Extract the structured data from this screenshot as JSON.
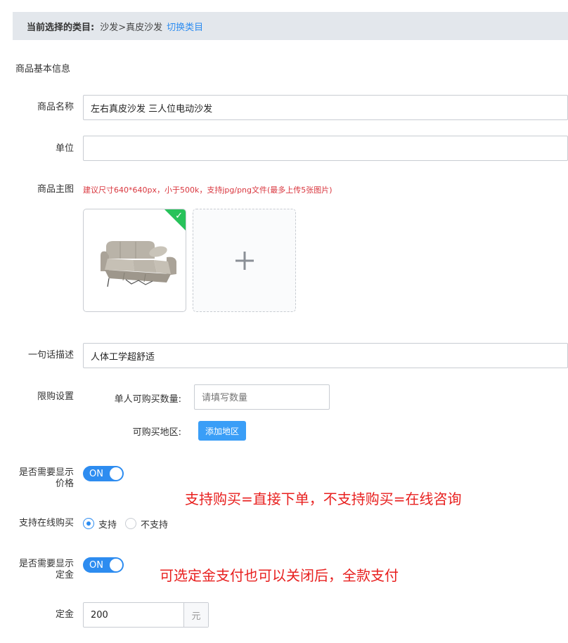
{
  "category_bar": {
    "label": "当前选择的类目:",
    "path": "沙发>真皮沙发",
    "switch_link": "切换类目"
  },
  "section_title": "商品基本信息",
  "product_name": {
    "label": "商品名称",
    "value": "左右真皮沙发 三人位电动沙发"
  },
  "unit": {
    "label": "单位",
    "value": ""
  },
  "main_image": {
    "label": "商品主图",
    "hint": "建议尺寸640*640px，小于500k，支持jpg/png文件(最多上传5张图片)",
    "uploaded_count": 1,
    "upload_icon": "plus-icon",
    "selected_icon": "check-icon"
  },
  "description": {
    "label": "一句话描述",
    "value": "人体工学超舒适"
  },
  "purchase_limit": {
    "label": "限购设置",
    "qty_label": "单人可购买数量:",
    "qty_placeholder": "请填写数量",
    "region_label": "可购买地区:",
    "add_region_button": "添加地区"
  },
  "show_price": {
    "label_line1": "是否需要显示",
    "label_line2": "价格",
    "switch_text": "ON",
    "state": true
  },
  "annotation_1": "支持购买=直接下单，不支持购买=在线咨询",
  "online_purchase": {
    "label": "支持在线购买",
    "options": [
      "支持",
      "不支持"
    ],
    "selected": "支持"
  },
  "show_deposit": {
    "label_line1": "是否需要显示",
    "label_line2": "定金",
    "switch_text": "ON",
    "state": true
  },
  "annotation_2": "可选定金支付也可以关闭后，全款支付",
  "deposit": {
    "label": "定金",
    "value": "200",
    "unit": "元"
  },
  "colors": {
    "primary": "#2d8cf0",
    "button": "#3a9ef7",
    "annotation": "#e8201f",
    "hint": "#d9363e",
    "success": "#27c25a"
  }
}
